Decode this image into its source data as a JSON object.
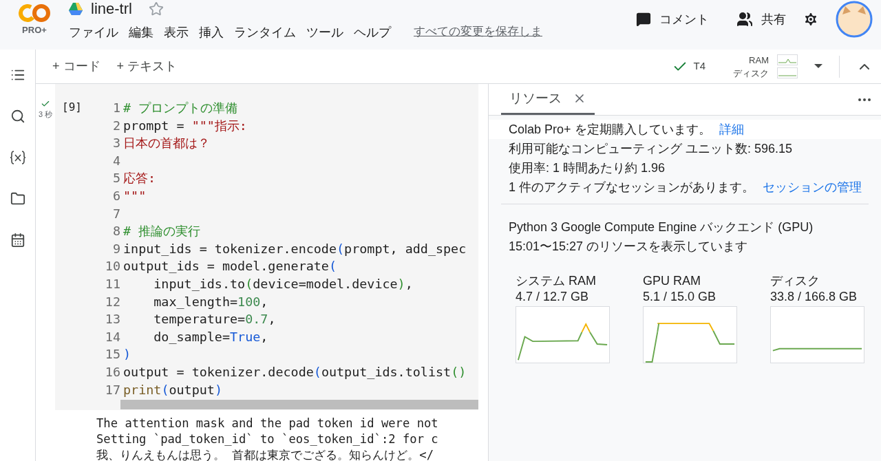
{
  "header": {
    "logo_badge": "PRO+",
    "title": "line-trl",
    "starred": false,
    "menu": [
      "ファイル",
      "編集",
      "表示",
      "挿入",
      "ランタイム",
      "ツール",
      "ヘルプ"
    ],
    "save_status": "すべての変更を保存しま",
    "actions": [
      {
        "kind": "comment",
        "label": "コメント"
      },
      {
        "kind": "share",
        "label": "共有"
      },
      {
        "kind": "settings"
      }
    ]
  },
  "toolbar": {
    "add_buttons": [
      "+ コード",
      "+ テキスト"
    ],
    "runtime": "T4",
    "meters": [
      "RAM",
      "ディスク"
    ]
  },
  "sidebar": {
    "items": [
      {
        "kind": "toc",
        "selected": false
      },
      {
        "kind": "search",
        "selected": false
      },
      {
        "kind": "variables",
        "selected": false
      },
      {
        "kind": "files",
        "selected": false
      },
      {
        "kind": "calendar",
        "selected": false
      }
    ]
  },
  "cell": {
    "exec_count": "[9]",
    "duration": "3 秒",
    "ok": true,
    "lines": [
      {
        "n": "1",
        "tokens": [
          {
            "kind": "comment",
            "text": "# プロンプトの準備"
          }
        ]
      },
      {
        "n": "2",
        "tokens": [
          {
            "kind": "plain",
            "text": "prompt = "
          },
          {
            "kind": "string",
            "text": "\"\"\"指示:"
          }
        ]
      },
      {
        "n": "3",
        "tokens": [
          {
            "kind": "string",
            "text": "日本の首都は？"
          }
        ]
      },
      {
        "n": "4"
      },
      {
        "n": "5",
        "tokens": [
          {
            "kind": "string",
            "text": "応答:"
          }
        ]
      },
      {
        "n": "6",
        "tokens": [
          {
            "kind": "string",
            "text": "\"\"\""
          }
        ]
      },
      {
        "n": "7"
      },
      {
        "n": "8",
        "tokens": [
          {
            "kind": "comment",
            "text": "# 推論の実行"
          }
        ]
      },
      {
        "n": "9",
        "tokens": [
          {
            "kind": "plain",
            "text": "input_ids = tokenizer.encode"
          },
          {
            "kind": "paren",
            "text": "("
          },
          {
            "kind": "plain",
            "text": "prompt, add_spec"
          }
        ]
      },
      {
        "n": "10",
        "tokens": [
          {
            "kind": "plain",
            "text": "output_ids = model.generate"
          },
          {
            "kind": "paren",
            "text": "("
          }
        ]
      },
      {
        "n": "11",
        "tokens": [
          {
            "kind": "plain",
            "text": "    input_ids.to"
          },
          {
            "kind": "paren2",
            "text": "("
          },
          {
            "kind": "plain",
            "text": "device=model.device"
          },
          {
            "kind": "paren2",
            "text": ")"
          },
          {
            "kind": "plain",
            "text": ","
          }
        ]
      },
      {
        "n": "12",
        "tokens": [
          {
            "kind": "plain",
            "text": "    max_length="
          },
          {
            "kind": "number",
            "text": "100"
          },
          {
            "kind": "plain",
            "text": ","
          }
        ]
      },
      {
        "n": "13",
        "tokens": [
          {
            "kind": "plain",
            "text": "    temperature="
          },
          {
            "kind": "number",
            "text": "0.7"
          },
          {
            "kind": "plain",
            "text": ","
          }
        ]
      },
      {
        "n": "14",
        "tokens": [
          {
            "kind": "plain",
            "text": "    do_sample="
          },
          {
            "kind": "keyword",
            "text": "True"
          },
          {
            "kind": "plain",
            "text": ","
          }
        ]
      },
      {
        "n": "15",
        "tokens": [
          {
            "kind": "paren",
            "text": ")"
          }
        ]
      },
      {
        "n": "16",
        "tokens": [
          {
            "kind": "plain",
            "text": "output = tokenizer.decode"
          },
          {
            "kind": "paren",
            "text": "("
          },
          {
            "kind": "plain",
            "text": "output_ids.tolist"
          },
          {
            "kind": "paren2",
            "text": "()"
          }
        ]
      },
      {
        "n": "17",
        "tokens": [
          {
            "kind": "builtin",
            "text": "print"
          },
          {
            "kind": "paren",
            "text": "("
          },
          {
            "kind": "plain",
            "text": "output"
          },
          {
            "kind": "paren",
            "text": ")"
          }
        ]
      }
    ],
    "output": [
      "The attention mask and the pad token id were not",
      "Setting `pad_token_id` to `eos_token_id`:2 for c",
      "我、りんえもんは思う。 首都は東京でござる。知らんけど。</"
    ]
  },
  "resources": {
    "tab": {
      "label": "リソース",
      "selected": true
    },
    "info": [
      {
        "text": "Colab Pro+ を定期購入しています。",
        "link": "詳細"
      },
      {
        "text": "利用可能なコンピューティング ユニット数: 596.15"
      },
      {
        "text": "使用率: 1 時間あたり約 1.96"
      },
      {
        "text": "1 件のアクティブなセッションがあります。",
        "link": "セッションの管理"
      }
    ],
    "backend": "Python 3 Google Compute Engine バックエンド (GPU)",
    "period": "15:01〜15:27 のリソースを表示しています",
    "gauges": [
      {
        "label": "システム RAM",
        "value": "4.7 / 12.7 GB",
        "kind": "spike"
      },
      {
        "label": "GPU RAM",
        "value": "5.1 / 15.0 GB",
        "kind": "plateau"
      },
      {
        "label": "ディスク",
        "value": "33.8 / 166.8 GB",
        "kind": "flat"
      }
    ]
  }
}
